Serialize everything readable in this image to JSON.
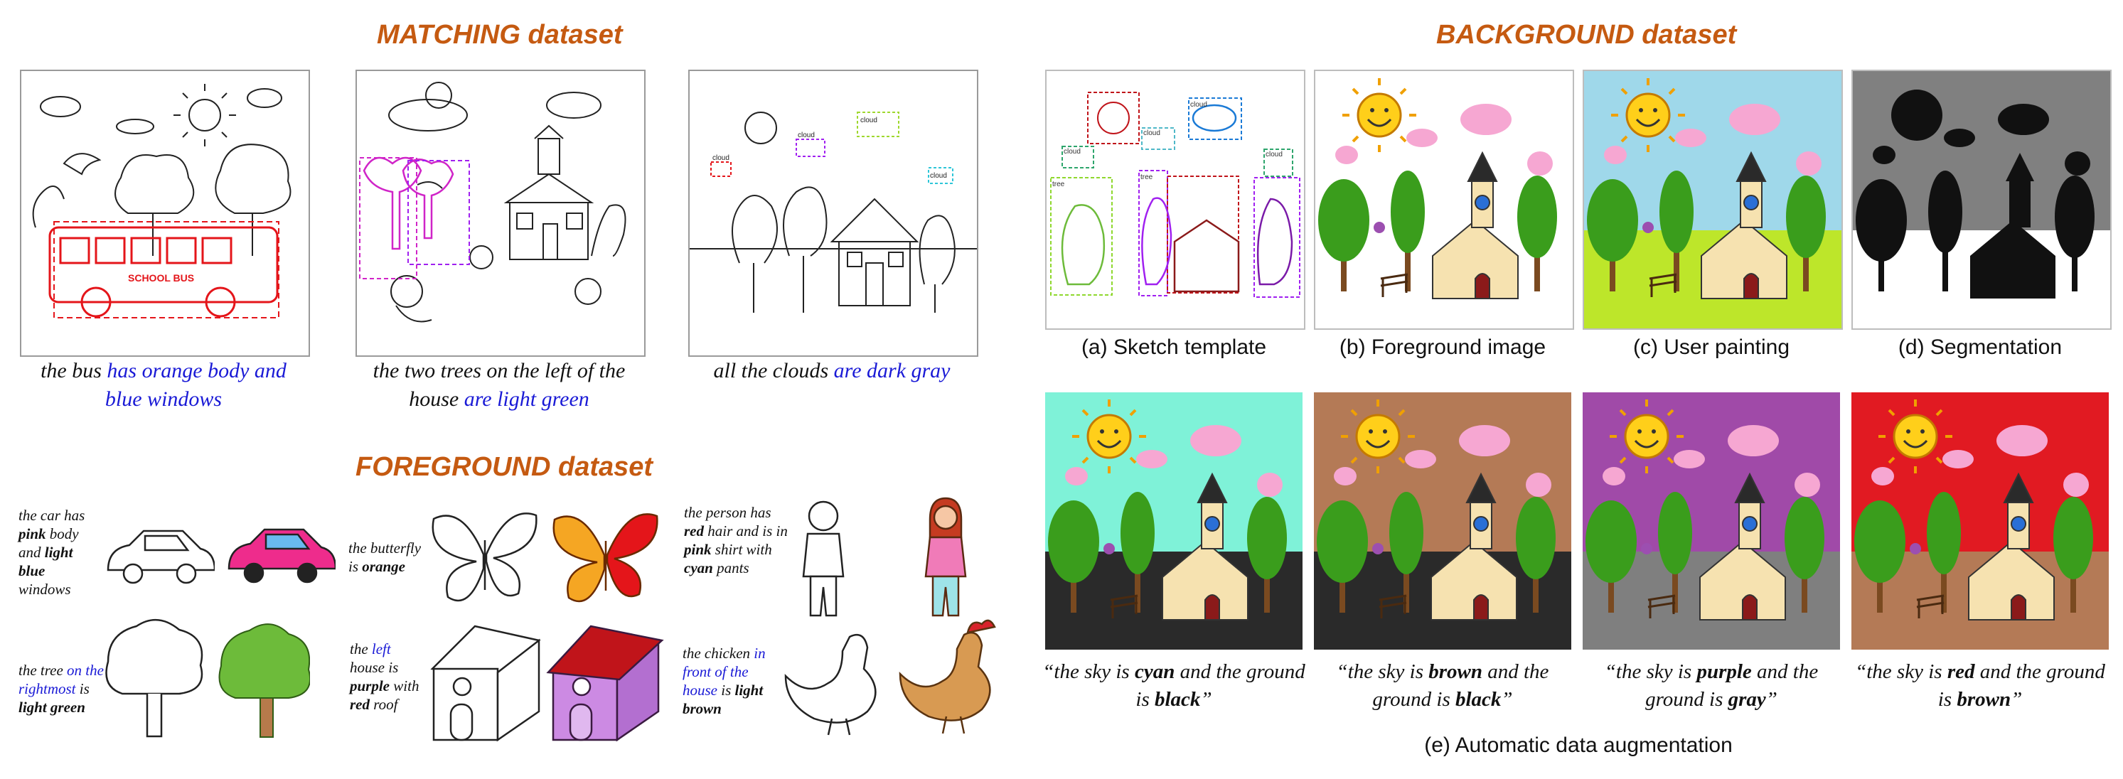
{
  "matching": {
    "title": "MATCHING dataset",
    "captions": [
      {
        "plain": "the bus ",
        "highlight": "has orange body and blue windows"
      },
      {
        "plain": "the two trees on the left of the house ",
        "highlight": "are light green"
      },
      {
        "plain": "all the clouds ",
        "highlight": "are dark gray"
      }
    ],
    "bus_label": "SCHOOL BUS",
    "box_labels": [
      "cloud",
      "cloud",
      "cloud",
      "cloud"
    ]
  },
  "foreground": {
    "title": "FOREGROUND dataset",
    "items": [
      {
        "text_html": "the car has <b>pink</b> body and <b>light blue</b> windows"
      },
      {
        "text_html": "the butterfly is <b>orange</b>"
      },
      {
        "text_html": "the person has <b>red</b> hair and is in <b>pink</b> shirt with <b>cyan</b> pants"
      },
      {
        "text_html": "the tree <span class='hl'>on the rightmost</span> is <b>light green</b>"
      },
      {
        "text_html": "the <span class='hl'>left</span> house is <b>purple</b> with <b>red</b> roof"
      },
      {
        "text_html": "the chicken <span class='hl'>in front of the house</span> is <b>light brown</b>"
      }
    ]
  },
  "background": {
    "title": "BACKGROUND dataset",
    "panels": [
      {
        "label": "(a) Sketch template"
      },
      {
        "label": "(b) Foreground image"
      },
      {
        "label": "(c) User painting"
      },
      {
        "label": "(d) Segmentation"
      }
    ],
    "sketch_box_labels": [
      "cloud",
      "cloud",
      "cloud",
      "cloud",
      "tree",
      "tree"
    ],
    "augmentation": {
      "label": "(e) Automatic data augmentation",
      "items": [
        {
          "sky": "cyan",
          "ground": "black",
          "sky_color": "#7ff2d8",
          "ground_color": "#2a2a2a"
        },
        {
          "sky": "brown",
          "ground": "black",
          "sky_color": "#b47a56",
          "ground_color": "#2a2a2a"
        },
        {
          "sky": "purple",
          "ground": "gray",
          "sky_color": "#a04aa8",
          "ground_color": "#7f7f7f"
        },
        {
          "sky": "red",
          "ground": "brown",
          "sky_color": "#e11a22",
          "ground_color": "#b47a56"
        }
      ]
    },
    "painting_colors": {
      "sky": "#9fd8ea",
      "ground": "#bde62a"
    }
  }
}
